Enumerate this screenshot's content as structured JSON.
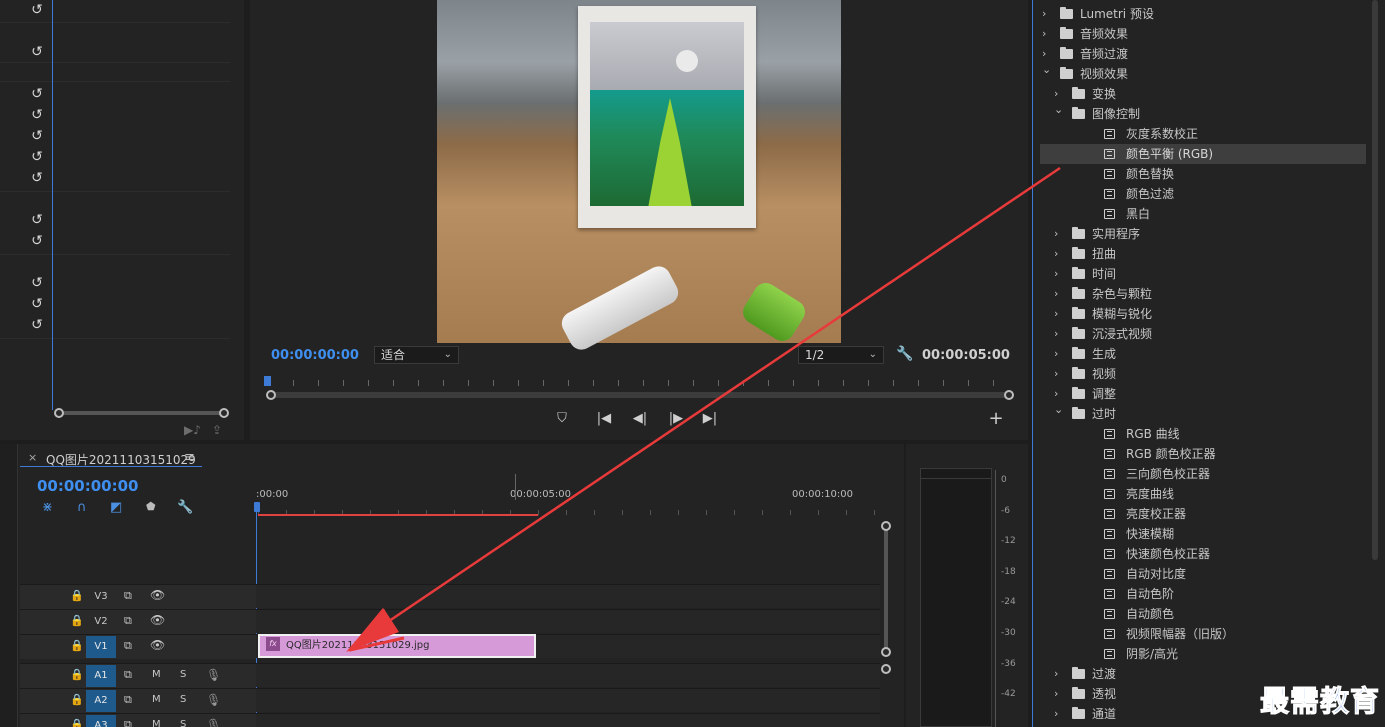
{
  "effect_controls": {
    "reset_icon": "↺",
    "bottom_icons": [
      "▶♪",
      "⇪"
    ]
  },
  "program_monitor": {
    "timecode_current": "00:00:00:00",
    "fit_dropdown": "适合",
    "resolution_dropdown": "1/2",
    "timecode_duration": "00:00:05:00",
    "wrench_icon": "wrench-icon",
    "transport": {
      "marker": "⛉",
      "goto_in": "|◀",
      "step_back": "◀|",
      "step_forward": "|▶",
      "goto_out": "▶|",
      "add": "+"
    }
  },
  "timeline": {
    "close": "×",
    "sequence_name": "QQ图片20211103151029",
    "menu": "≡",
    "timecode": "00:00:00:00",
    "ruler_labels": [
      ":00:00",
      "00:00:05:00",
      "00:00:10:00"
    ],
    "tools": [
      "⋇",
      "∩",
      "◩",
      "⬟",
      "🔧"
    ],
    "tracks": [
      {
        "name": "V3",
        "type": "video",
        "active": false
      },
      {
        "name": "V2",
        "type": "video",
        "active": false
      },
      {
        "name": "V1",
        "type": "video",
        "active": true
      },
      {
        "name": "A1",
        "type": "audio",
        "active": true
      },
      {
        "name": "A2",
        "type": "audio",
        "active": true
      },
      {
        "name": "A3",
        "type": "audio",
        "active": true
      }
    ],
    "track_m": "M",
    "track_s": "S",
    "clip": {
      "fx": "fx",
      "label": "QQ图片20211103151029.jpg"
    }
  },
  "audio_meter": {
    "db_labels": [
      "0",
      "-6",
      "-12",
      "-18",
      "-24",
      "-30",
      "-36",
      "-42"
    ]
  },
  "effects_panel": {
    "items": [
      {
        "level": 0,
        "kind": "folder",
        "expanded": false,
        "label": "Lumetri 预设"
      },
      {
        "level": 0,
        "kind": "folder",
        "expanded": false,
        "label": "音频效果"
      },
      {
        "level": 0,
        "kind": "folder",
        "expanded": false,
        "label": "音频过渡"
      },
      {
        "level": 0,
        "kind": "folder",
        "expanded": true,
        "label": "视频效果"
      },
      {
        "level": 1,
        "kind": "folder",
        "expanded": false,
        "label": "变换"
      },
      {
        "level": 1,
        "kind": "folder",
        "expanded": true,
        "label": "图像控制"
      },
      {
        "level": 2,
        "kind": "effect",
        "label": "灰度系数校正"
      },
      {
        "level": 2,
        "kind": "effect",
        "label": "颜色平衡 (RGB)",
        "selected": true
      },
      {
        "level": 2,
        "kind": "effect",
        "label": "颜色替换"
      },
      {
        "level": 2,
        "kind": "effect",
        "label": "颜色过滤"
      },
      {
        "level": 2,
        "kind": "effect",
        "label": "黑白"
      },
      {
        "level": 1,
        "kind": "folder",
        "expanded": false,
        "label": "实用程序"
      },
      {
        "level": 1,
        "kind": "folder",
        "expanded": false,
        "label": "扭曲"
      },
      {
        "level": 1,
        "kind": "folder",
        "expanded": false,
        "label": "时间"
      },
      {
        "level": 1,
        "kind": "folder",
        "expanded": false,
        "label": "杂色与颗粒"
      },
      {
        "level": 1,
        "kind": "folder",
        "expanded": false,
        "label": "模糊与锐化"
      },
      {
        "level": 1,
        "kind": "folder",
        "expanded": false,
        "label": "沉浸式视频"
      },
      {
        "level": 1,
        "kind": "folder",
        "expanded": false,
        "label": "生成"
      },
      {
        "level": 1,
        "kind": "folder",
        "expanded": false,
        "label": "视频"
      },
      {
        "level": 1,
        "kind": "folder",
        "expanded": false,
        "label": "调整"
      },
      {
        "level": 1,
        "kind": "folder",
        "expanded": true,
        "label": "过时"
      },
      {
        "level": 2,
        "kind": "effect",
        "label": "RGB 曲线"
      },
      {
        "level": 2,
        "kind": "effect",
        "label": "RGB 颜色校正器"
      },
      {
        "level": 2,
        "kind": "effect",
        "label": "三向颜色校正器"
      },
      {
        "level": 2,
        "kind": "effect",
        "label": "亮度曲线"
      },
      {
        "level": 2,
        "kind": "effect",
        "label": "亮度校正器"
      },
      {
        "level": 2,
        "kind": "effect",
        "label": "快速模糊"
      },
      {
        "level": 2,
        "kind": "effect",
        "label": "快速颜色校正器"
      },
      {
        "level": 2,
        "kind": "effect",
        "label": "自动对比度"
      },
      {
        "level": 2,
        "kind": "effect",
        "label": "自动色阶"
      },
      {
        "level": 2,
        "kind": "effect",
        "label": "自动颜色"
      },
      {
        "level": 2,
        "kind": "effect",
        "label": "视频限幅器（旧版）"
      },
      {
        "level": 2,
        "kind": "effect",
        "label": "阴影/高光"
      },
      {
        "level": 1,
        "kind": "folder",
        "expanded": false,
        "label": "过渡"
      },
      {
        "level": 1,
        "kind": "folder",
        "expanded": false,
        "label": "透视"
      },
      {
        "level": 1,
        "kind": "folder",
        "expanded": false,
        "label": "通道"
      }
    ]
  },
  "watermark": "最需教育",
  "colors": {
    "accent_blue": "#3f8ff0",
    "work_area_red": "#e04242",
    "clip_pink": "#d79ad9",
    "annotation_arrow": "#e83a3a"
  }
}
